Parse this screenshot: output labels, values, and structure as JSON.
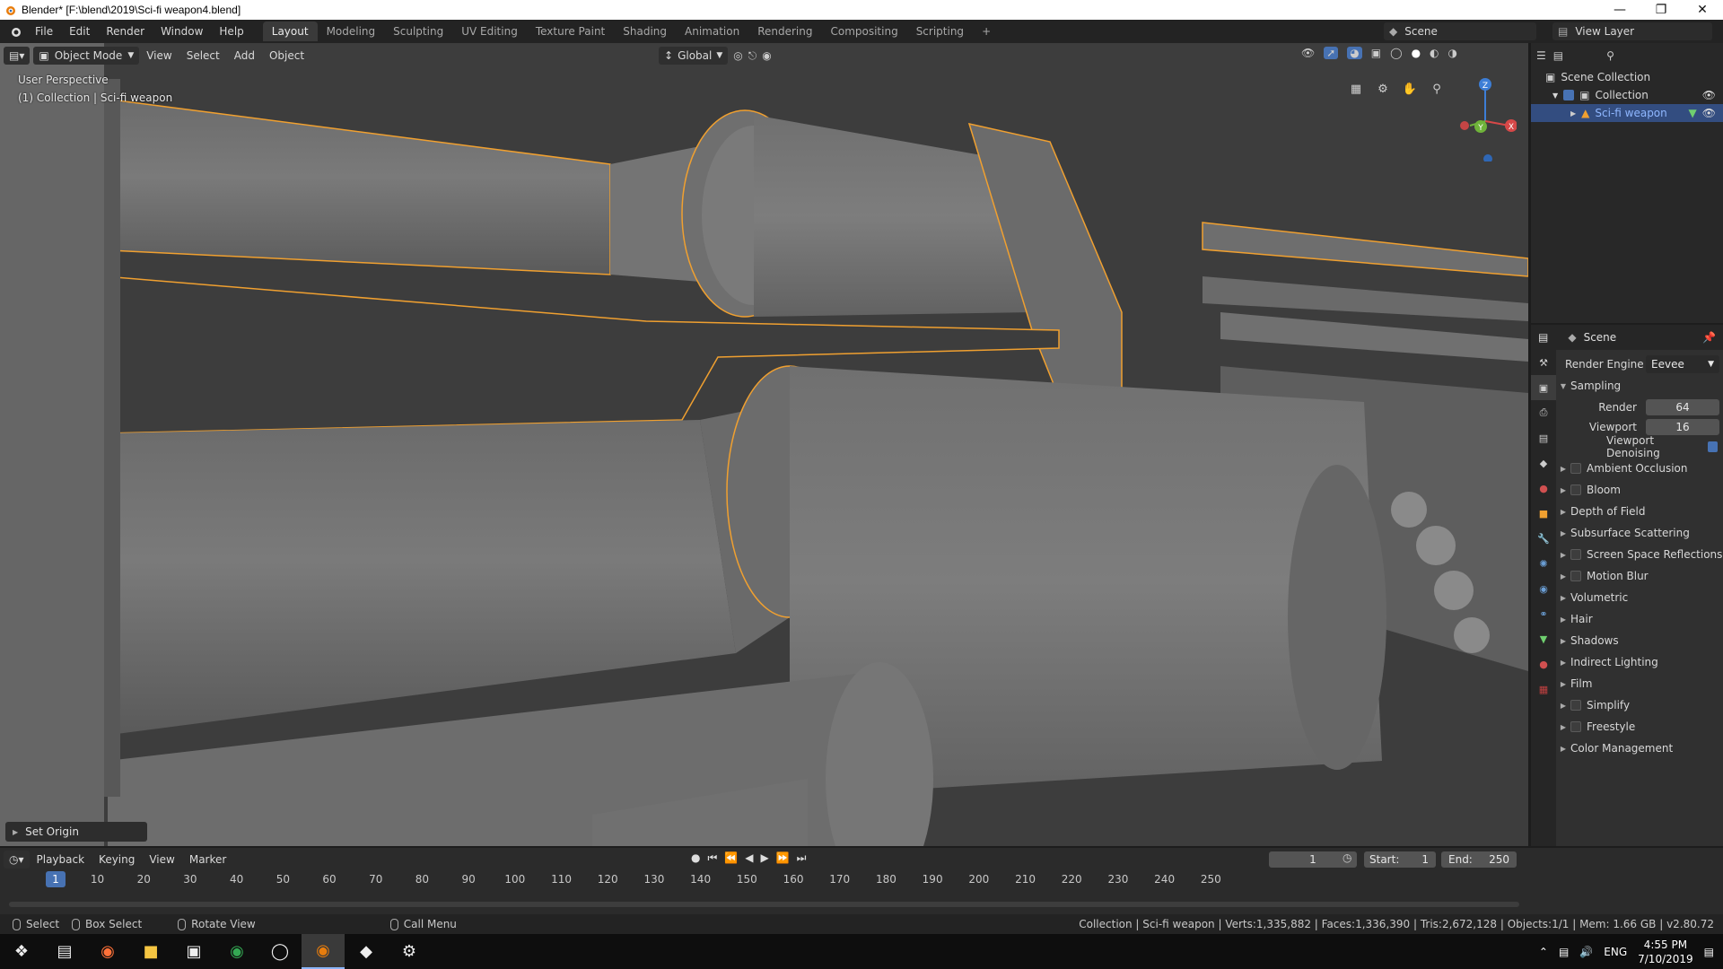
{
  "window": {
    "title": "Blender* [F:\\blend\\2019\\Sci-fi weapon4.blend]"
  },
  "menus": [
    "File",
    "Edit",
    "Render",
    "Window",
    "Help"
  ],
  "workspaces": {
    "tabs": [
      "Layout",
      "Modeling",
      "Sculpting",
      "UV Editing",
      "Texture Paint",
      "Shading",
      "Animation",
      "Rendering",
      "Compositing",
      "Scripting"
    ],
    "active": "Layout"
  },
  "scene_name": "Scene",
  "view_layer_name": "View Layer",
  "viewport": {
    "mode": "Object Mode",
    "menus": [
      "View",
      "Select",
      "Add",
      "Object"
    ],
    "orientation": "Global",
    "perspective_label": "User Perspective",
    "collection_label": "(1) Collection | Sci-fi weapon",
    "gizmo_axes": [
      "X",
      "Y",
      "Z"
    ],
    "last_op": "Set Origin"
  },
  "outliner": {
    "root": "Scene Collection",
    "collection": "Collection",
    "object": "Sci-fi weapon"
  },
  "properties": {
    "context": "Scene",
    "render_engine_label": "Render Engine",
    "render_engine": "Eevee",
    "sampling_label": "Sampling",
    "render_label": "Render",
    "render_samples": "64",
    "viewport_label": "Viewport",
    "viewport_samples": "16",
    "viewport_denoising": "Viewport Denoising",
    "panels": [
      {
        "label": "Ambient Occlusion",
        "check": true
      },
      {
        "label": "Bloom",
        "check": true
      },
      {
        "label": "Depth of Field",
        "check": false
      },
      {
        "label": "Subsurface Scattering",
        "check": false
      },
      {
        "label": "Screen Space Reflections",
        "check": true
      },
      {
        "label": "Motion Blur",
        "check": true
      },
      {
        "label": "Volumetric",
        "check": false
      },
      {
        "label": "Hair",
        "check": false
      },
      {
        "label": "Shadows",
        "check": false
      },
      {
        "label": "Indirect Lighting",
        "check": false
      },
      {
        "label": "Film",
        "check": false
      },
      {
        "label": "Simplify",
        "check": true
      },
      {
        "label": "Freestyle",
        "check": true
      },
      {
        "label": "Color Management",
        "check": false
      }
    ]
  },
  "timeline": {
    "menus": [
      "Playback",
      "Keying",
      "View",
      "Marker"
    ],
    "current_frame": "1",
    "start_label": "Start:",
    "start": "1",
    "end_label": "End:",
    "end": "250",
    "ticks": [
      "10",
      "20",
      "30",
      "40",
      "50",
      "60",
      "70",
      "80",
      "90",
      "100",
      "110",
      "120",
      "130",
      "140",
      "150",
      "160",
      "170",
      "180",
      "190",
      "200",
      "210",
      "220",
      "230",
      "240",
      "250"
    ]
  },
  "statusbar": {
    "select": "Select",
    "box_select": "Box Select",
    "rotate_view": "Rotate View",
    "call_menu": "Call Menu",
    "stats": "Collection | Sci-fi weapon | Verts:1,335,882 | Faces:1,336,390 | Tris:2,672,128 | Objects:1/1 | Mem: 1.66 GB | v2.80.72"
  },
  "taskbar": {
    "language": "ENG",
    "time": "4:55 PM",
    "date": "7/10/2019"
  }
}
